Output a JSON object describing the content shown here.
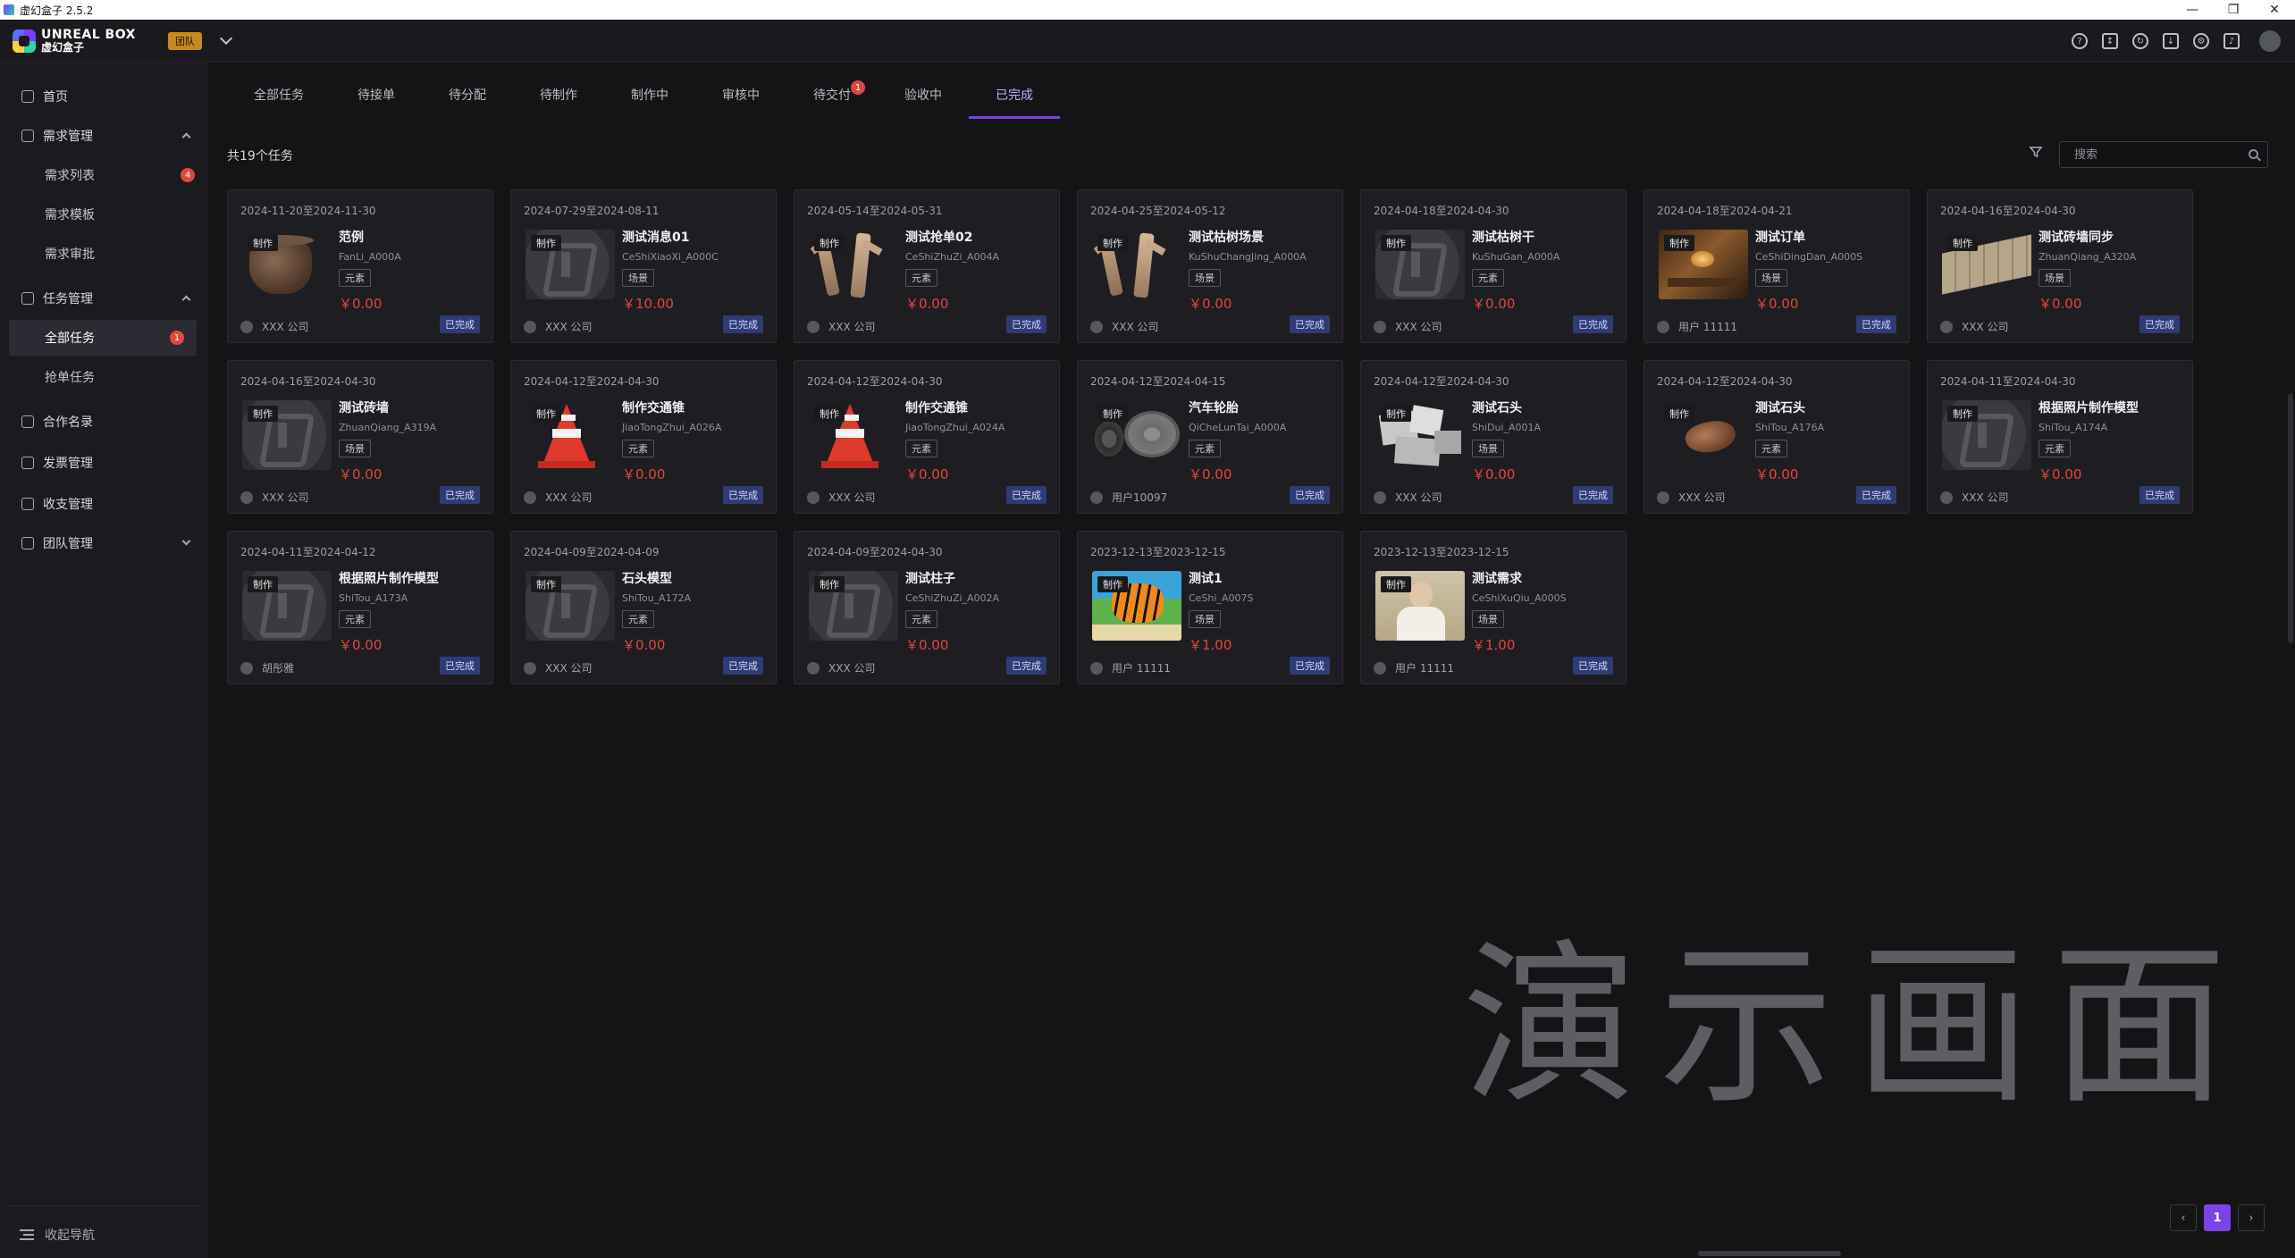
{
  "window": {
    "title": "虚幻盒子 2.5.2",
    "controls": [
      "—",
      "❐",
      "✕"
    ]
  },
  "header": {
    "logo_line1": "UNREAL BOX",
    "logo_line2": "虚幻盒子",
    "team_label": "团队",
    "icons": [
      "help-icon",
      "sort-icon",
      "refresh-icon",
      "download-icon",
      "settings-icon",
      "bell-icon",
      "user-avatar"
    ]
  },
  "sidebar": {
    "items": [
      {
        "label": "首页",
        "icon": "home-icon"
      },
      {
        "label": "需求管理",
        "icon": "list-icon"
      },
      {
        "label": "需求列表",
        "badge": "4"
      },
      {
        "label": "需求模板"
      },
      {
        "label": "需求审批"
      },
      {
        "label": "任务管理",
        "icon": "task-icon"
      },
      {
        "label": "全部任务",
        "badge": "1"
      },
      {
        "label": "抢单任务"
      },
      {
        "label": "合作名录",
        "icon": "contacts-icon"
      },
      {
        "label": "发票管理",
        "icon": "invoice-icon"
      },
      {
        "label": "收支管理",
        "icon": "wallet-icon"
      },
      {
        "label": "团队管理",
        "icon": "team-icon"
      }
    ],
    "collapse_label": "收起导航"
  },
  "tabs": [
    {
      "label": "全部任务"
    },
    {
      "label": "待接单"
    },
    {
      "label": "待分配"
    },
    {
      "label": "待制作"
    },
    {
      "label": "制作中"
    },
    {
      "label": "审核中"
    },
    {
      "label": "待交付",
      "badge": "1"
    },
    {
      "label": "验收中"
    },
    {
      "label": "已完成",
      "active": true
    }
  ],
  "toolbar": {
    "count_text": "共19个任务",
    "search_placeholder": "搜索"
  },
  "cards": [
    {
      "dates": "2024-11-20至2024-11-30",
      "tag": "制作",
      "title": "范例",
      "code": "FanLi_A000A",
      "type": "元素",
      "price": "￥0.00",
      "owner": "XXX 公司",
      "status": "已完成",
      "thumb": "pot"
    },
    {
      "dates": "2024-07-29至2024-08-11",
      "tag": "制作",
      "title": "测试消息01",
      "code": "CeShiXiaoXi_A000C",
      "type": "场景",
      "price": "￥10.00",
      "owner": "XXX 公司",
      "status": "已完成",
      "thumb": "logo"
    },
    {
      "dates": "2024-05-14至2024-05-31",
      "tag": "制作",
      "title": "测试抢单02",
      "code": "CeShiZhuZi_A004A",
      "type": "元素",
      "price": "￥0.00",
      "owner": "XXX 公司",
      "status": "已完成",
      "thumb": "wood"
    },
    {
      "dates": "2024-04-25至2024-05-12",
      "tag": "制作",
      "title": "测试枯树场景",
      "code": "KuShuChangJing_A000A",
      "type": "场景",
      "price": "￥0.00",
      "owner": "XXX 公司",
      "status": "已完成",
      "thumb": "wood"
    },
    {
      "dates": "2024-04-18至2024-04-30",
      "tag": "制作",
      "title": "测试枯树干",
      "code": "KuShuGan_A000A",
      "type": "元素",
      "price": "￥0.00",
      "owner": "XXX 公司",
      "status": "已完成",
      "thumb": "logo"
    },
    {
      "dates": "2024-04-18至2024-04-21",
      "tag": "制作",
      "title": "测试订单",
      "code": "CeShiDingDan_A000S",
      "type": "场景",
      "price": "￥0.00",
      "owner": "用户 11111",
      "status": "已完成",
      "thumb": "room"
    },
    {
      "dates": "2024-04-16至2024-04-30",
      "tag": "制作",
      "title": "测试砖墙同步",
      "code": "ZhuanQiang_A320A",
      "type": "场景",
      "price": "￥0.00",
      "owner": "XXX 公司",
      "status": "已完成",
      "thumb": "wall"
    },
    {
      "dates": "2024-04-16至2024-04-30",
      "tag": "制作",
      "title": "测试砖墙",
      "code": "ZhuanQiang_A319A",
      "type": "场景",
      "price": "￥0.00",
      "owner": "XXX 公司",
      "status": "已完成",
      "thumb": "logo"
    },
    {
      "dates": "2024-04-12至2024-04-30",
      "tag": "制作",
      "title": "制作交通锥",
      "code": "JiaoTongZhui_A026A",
      "type": "元素",
      "price": "￥0.00",
      "owner": "XXX 公司",
      "status": "已完成",
      "thumb": "cone"
    },
    {
      "dates": "2024-04-12至2024-04-30",
      "tag": "制作",
      "title": "制作交通锥",
      "code": "JiaoTongZhui_A024A",
      "type": "元素",
      "price": "￥0.00",
      "owner": "XXX 公司",
      "status": "已完成",
      "thumb": "cone"
    },
    {
      "dates": "2024-04-12至2024-04-15",
      "tag": "制作",
      "title": "汽车轮胎",
      "code": "QiCheLunTai_A000A",
      "type": "元素",
      "price": "￥0.00",
      "owner": "用户10097",
      "status": "已完成",
      "thumb": "tire"
    },
    {
      "dates": "2024-04-12至2024-04-30",
      "tag": "制作",
      "title": "测试石头",
      "code": "ShiDui_A001A",
      "type": "场景",
      "price": "￥0.00",
      "owner": "XXX 公司",
      "status": "已完成",
      "thumb": "stone"
    },
    {
      "dates": "2024-04-12至2024-04-30",
      "tag": "制作",
      "title": "测试石头",
      "code": "ShiTou_A176A",
      "type": "元素",
      "price": "￥0.00",
      "owner": "XXX 公司",
      "status": "已完成",
      "thumb": "rock"
    },
    {
      "dates": "2024-04-11至2024-04-30",
      "tag": "制作",
      "title": "根据照片制作模型",
      "code": "ShiTou_A174A",
      "type": "元素",
      "price": "￥0.00",
      "owner": "XXX 公司",
      "status": "已完成",
      "thumb": "logo"
    },
    {
      "dates": "2024-04-11至2024-04-12",
      "tag": "制作",
      "title": "根据照片制作模型",
      "code": "ShiTou_A173A",
      "type": "元素",
      "price": "￥0.00",
      "owner": "胡彤雅",
      "status": "已完成",
      "thumb": "logo"
    },
    {
      "dates": "2024-04-09至2024-04-09",
      "tag": "制作",
      "title": "石头模型",
      "code": "ShiTou_A172A",
      "type": "元素",
      "price": "￥0.00",
      "owner": "XXX 公司",
      "status": "已完成",
      "thumb": "logo"
    },
    {
      "dates": "2024-04-09至2024-04-30",
      "tag": "制作",
      "title": "测试柱子",
      "code": "CeShiZhuZi_A002A",
      "type": "元素",
      "price": "￥0.00",
      "owner": "XXX 公司",
      "status": "已完成",
      "thumb": "logo"
    },
    {
      "dates": "2023-12-13至2023-12-15",
      "tag": "制作",
      "title": "测试1",
      "code": "CeShi_A007S",
      "type": "场景",
      "price": "￥1.00",
      "owner": "用户 11111",
      "status": "已完成",
      "thumb": "tiger"
    },
    {
      "dates": "2023-12-13至2023-12-15",
      "tag": "制作",
      "title": "测试需求",
      "code": "CeShiXuQiu_A000S",
      "type": "场景",
      "price": "￥1.00",
      "owner": "用户 11111",
      "status": "已完成",
      "thumb": "portrait"
    }
  ],
  "watermark": "演示画面",
  "pagination": {
    "prev": "‹",
    "current": "1",
    "next": "›"
  }
}
